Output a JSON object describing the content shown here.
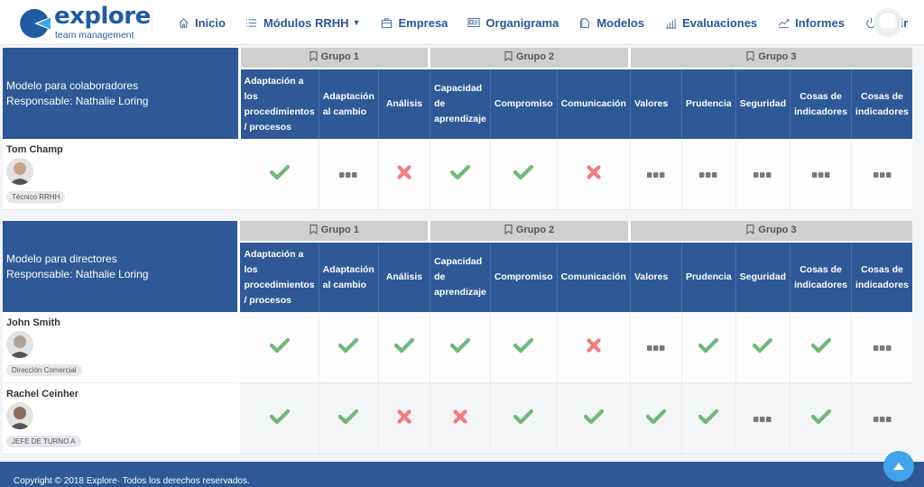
{
  "header": {
    "logo_text": "explore",
    "logo_subtitle": "team management",
    "nav": [
      {
        "label": "Inicio",
        "icon": "home-icon"
      },
      {
        "label": "Módulos RRHH",
        "icon": "list-icon",
        "dropdown": true
      },
      {
        "label": "Empresa",
        "icon": "briefcase-icon"
      },
      {
        "label": "Organigrama",
        "icon": "id-card-icon"
      },
      {
        "label": "Modelos",
        "icon": "documents-icon"
      },
      {
        "label": "Evaluaciones",
        "icon": "bar-chart-icon"
      },
      {
        "label": "Informes",
        "icon": "line-chart-icon"
      },
      {
        "label": "Salir",
        "icon": "power-icon"
      }
    ]
  },
  "groups": [
    {
      "label": "Grupo 1"
    },
    {
      "label": "Grupo 2"
    },
    {
      "label": "Grupo 3"
    }
  ],
  "competencies": [
    "Adaptación a los procedimientos / procesos",
    "Adaptación al cambio",
    "Análisis",
    "Capacidad de aprendizaje",
    "Compromiso",
    "Comunicación",
    "Valores",
    "Prudencia",
    "Seguridad",
    "Cosas de indicadores",
    "Cosas de indicadores"
  ],
  "models": [
    {
      "name": "Modelo para colaboradores",
      "responsible": "Responsable: Nathalie Loring",
      "employees": [
        {
          "name": "Tom Champ",
          "role": "Técnico RRHH",
          "values": [
            "check",
            "pending",
            "cross",
            "check",
            "check",
            "cross",
            "pending",
            "pending",
            "pending",
            "pending",
            "pending"
          ]
        }
      ]
    },
    {
      "name": "Modelo para directores",
      "responsible": "Responsable: Nathalie Loring",
      "employees": [
        {
          "name": "John Smith",
          "role": "Dirección Comercial",
          "values": [
            "check",
            "check",
            "check",
            "check",
            "check",
            "cross",
            "pending",
            "check",
            "check",
            "check",
            "pending"
          ]
        },
        {
          "name": "Rachel Ceinher",
          "role": "JEFE DE TURNO A",
          "values": [
            "check",
            "check",
            "cross",
            "cross",
            "check",
            "check",
            "check",
            "check",
            "pending",
            "check",
            "pending"
          ]
        }
      ]
    }
  ],
  "status_colors": {
    "check": "#72b77a",
    "cross": "#f07d80",
    "pending": "#7a7a7a",
    "header_blue": "#2e5896"
  },
  "footer": {
    "copyright": "Copyright © 2018 Explore· Todos los derechos reservados."
  }
}
